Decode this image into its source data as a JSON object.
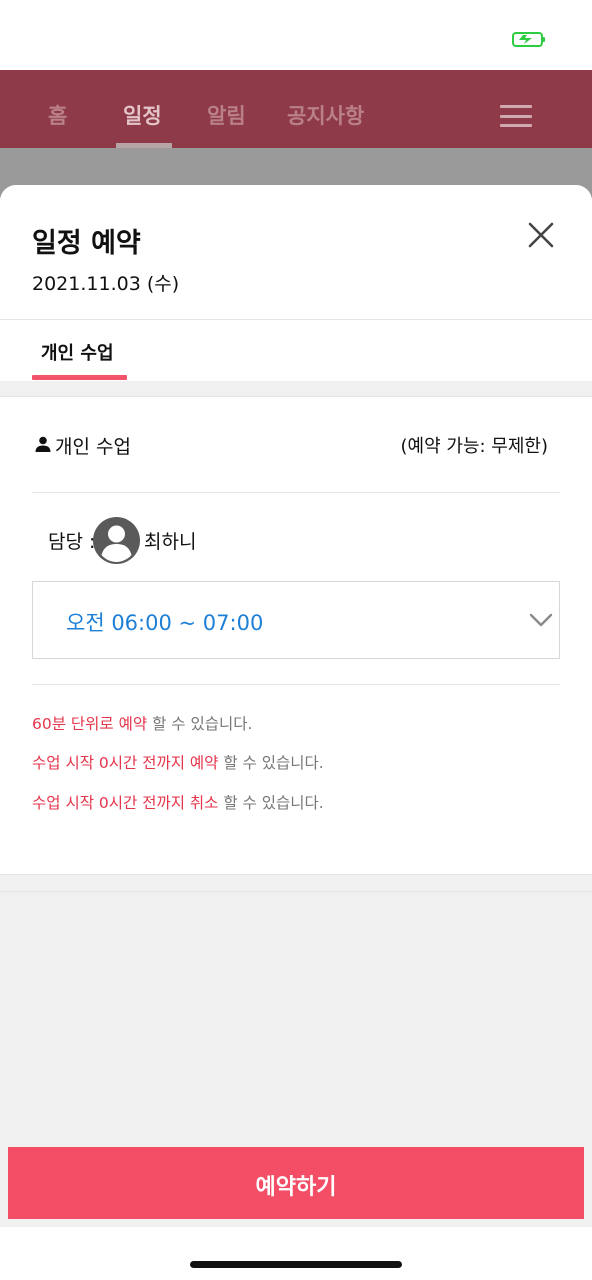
{
  "nav": {
    "tabs": [
      {
        "label": "홈"
      },
      {
        "label": "일정"
      },
      {
        "label": "알림"
      },
      {
        "label": "공지사항"
      }
    ],
    "active_tab": "일정"
  },
  "sheet": {
    "title": "일정 예약",
    "date": "2021.11.03 (수)",
    "tab_label": "개인 수업",
    "class_name": "개인 수업",
    "availability": "(예약 가능: 무제한)",
    "instructor_label": "담당 :",
    "instructor_name": "최하니",
    "selected_time": "오전 06:00 ~ 07:00",
    "notices": [
      {
        "highlight": "60분 단위로 예약",
        "rest": " 할 수 있습니다."
      },
      {
        "highlight": "수업 시작 0시간 전까지 예약",
        "rest": " 할 수 있습니다."
      },
      {
        "highlight": "수업 시작 0시간 전까지 취소",
        "rest": " 할 수 있습니다."
      }
    ],
    "reserve_button_label": "예약하기"
  },
  "icons": {
    "battery": "battery-charging-icon",
    "menu": "hamburger-menu-icon",
    "close": "close-icon",
    "person": "person-icon",
    "avatar": "user-avatar-icon",
    "dropdown": "chevron-down-icon"
  },
  "colors": {
    "brand_red": "#f44e66",
    "highlight_red": "#e5364b",
    "time_blue": "#1e7fd6",
    "nav_dimmed": "#8f3a48",
    "battery_green": "#2ecc40"
  }
}
